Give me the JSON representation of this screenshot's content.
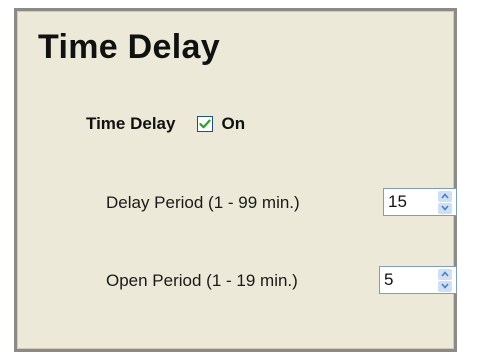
{
  "panel": {
    "title": "Time Delay"
  },
  "time_delay": {
    "label": "Time Delay",
    "checked": true,
    "state_label": "On"
  },
  "delay_period": {
    "label": "Delay Period (1 - 99 min.)",
    "value": "15"
  },
  "open_period": {
    "label": "Open Period (1 - 19 min.)",
    "value": "5"
  },
  "colors": {
    "panel_bg": "#ece9d8",
    "frame_border": "#8a8a86",
    "check_mark": "#2f9e2f",
    "spin_arrow": "#4b7ec0"
  }
}
